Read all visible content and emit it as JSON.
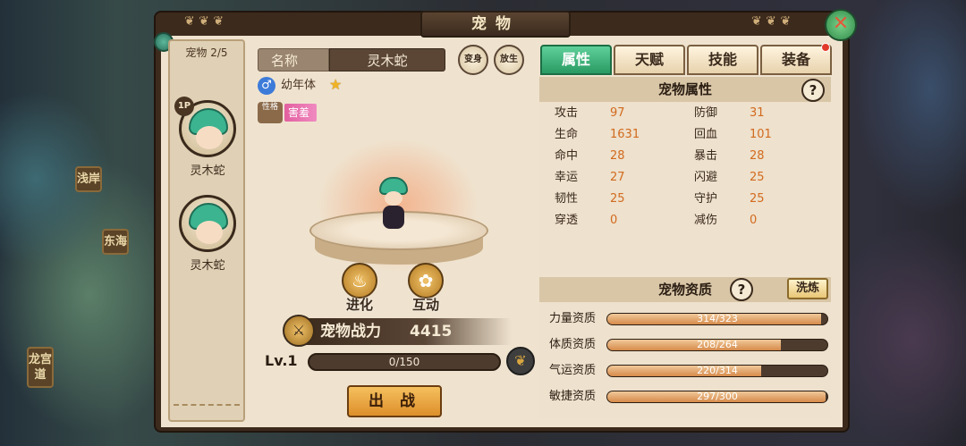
{
  "window": {
    "title": "宠物"
  },
  "map_labels": [
    "浅岸",
    "东海",
    "龙宫道"
  ],
  "pet_list": {
    "count_label": "宠物 2/5",
    "slots": [
      {
        "badge": "1P",
        "name": "灵木蛇"
      },
      {
        "badge": "",
        "name": "灵木蛇"
      }
    ]
  },
  "pet_info": {
    "name_label": "名称",
    "name_value": "灵木蛇",
    "release_label": "放生",
    "transform_label": "变身",
    "gender_icon": "male-icon",
    "stage": "幼年体",
    "star_icon": "star-icon",
    "trait_icon_label": "性格",
    "trait": "害羞"
  },
  "actions": {
    "evolve": "进化",
    "interact": "互动"
  },
  "power": {
    "label": "宠物战力",
    "value": "4415"
  },
  "level": {
    "label": "Lv.1",
    "exp_text": "0/150",
    "exp_progress": 0.0
  },
  "battle_button": "出 战",
  "tabs": [
    {
      "label": "属性",
      "active": true
    },
    {
      "label": "天赋",
      "active": false
    },
    {
      "label": "技能",
      "active": false
    },
    {
      "label": "装备",
      "active": false
    }
  ],
  "attributes": {
    "title": "宠物属性",
    "stats": [
      {
        "k": "攻击",
        "v": "97"
      },
      {
        "k": "防御",
        "v": "31"
      },
      {
        "k": "生命",
        "v": "1631"
      },
      {
        "k": "回血",
        "v": "101"
      },
      {
        "k": "命中",
        "v": "28"
      },
      {
        "k": "暴击",
        "v": "28"
      },
      {
        "k": "幸运",
        "v": "27"
      },
      {
        "k": "闪避",
        "v": "25"
      },
      {
        "k": "韧性",
        "v": "25"
      },
      {
        "k": "守护",
        "v": "25"
      },
      {
        "k": "穿透",
        "v": "0"
      },
      {
        "k": "减伤",
        "v": "0"
      }
    ]
  },
  "quality": {
    "title": "宠物资质",
    "refine_label": "洗炼",
    "rows": [
      {
        "label": "力量资质",
        "text": "314/323",
        "progress": 0.972
      },
      {
        "label": "体质资质",
        "text": "208/264",
        "progress": 0.788
      },
      {
        "label": "气运资质",
        "text": "220/314",
        "progress": 0.701
      },
      {
        "label": "敏捷资质",
        "text": "297/300",
        "progress": 0.99
      }
    ]
  },
  "colors": {
    "accent_tab": "#2a9a63",
    "stat_value": "#d26a1e",
    "bar_fill": "#d68a4a"
  }
}
